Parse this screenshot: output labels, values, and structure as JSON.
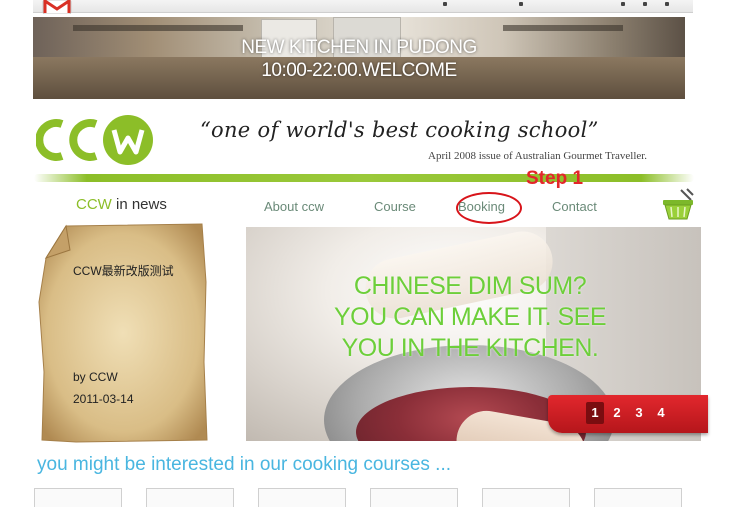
{
  "banner": {
    "line1": "NEW KITCHEN IN PUDONG",
    "line2": "10:00-22:00.WELCOME"
  },
  "header": {
    "slogan": "“one of world's best cooking school”",
    "slogan_source": "April 2008 issue of Australian Gourmet Traveller.",
    "step_label": "Step 1"
  },
  "news": {
    "title_brand": "CCW",
    "title_rest": " in news",
    "headline": "CCW最新改版测试",
    "by": "by CCW",
    "date": "2011-03-14"
  },
  "nav": {
    "items": [
      "About ccw",
      "Course",
      "Booking",
      "Contact"
    ]
  },
  "slideshow": {
    "caption": "CHINESE DIM SUM?YOU CAN MAKE IT. SEE YOU IN THE KITCHEN.",
    "pages": [
      "1",
      "2",
      "3",
      "4"
    ],
    "active_page": "1"
  },
  "courses": {
    "heading": "you might be interested in our cooking courses ..."
  },
  "colors": {
    "brand_green": "#8cbe28",
    "highlight_red": "#e3262a",
    "heading_blue": "#49b6e0"
  },
  "icons": [
    "gmail-icon",
    "ccw-logo",
    "shopping-basket-icon"
  ]
}
